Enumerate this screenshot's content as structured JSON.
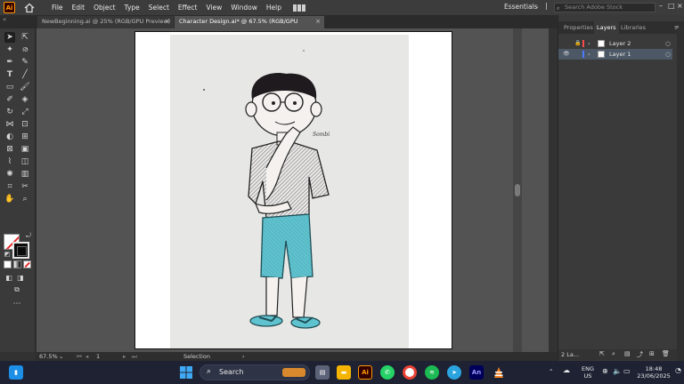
{
  "app": {
    "logo_text": "Ai",
    "menu": [
      "File",
      "Edit",
      "Object",
      "Type",
      "Select",
      "Effect",
      "View",
      "Window",
      "Help"
    ],
    "workspace": "Essentials",
    "stock_search_placeholder": "Search Adobe Stock"
  },
  "tabs": [
    {
      "label": "NewBeginning.ai @ 25% (RGB/GPU Preview)",
      "close": "×"
    },
    {
      "label": "Character Design.ai* @ 67.5% (RGB/GPU Preview)",
      "close": "×"
    }
  ],
  "panel": {
    "tabs": [
      "Properties",
      "Layers",
      "Libraries"
    ],
    "layers": [
      {
        "name": "Layer 2",
        "color": "#ff4b4b"
      },
      {
        "name": "Layer 1",
        "color": "#4b7bff"
      }
    ],
    "footer_count": "2 La..."
  },
  "artwork": {
    "signature": "Sombi"
  },
  "status": {
    "zoom": "67.5%",
    "artboard_nav": "1",
    "tool_name": "Selection"
  },
  "taskbar": {
    "search_label": "Search",
    "lang_top": "ENG",
    "lang_bottom": "US",
    "time": "18:48",
    "date": "23/06/2025"
  },
  "colors": {
    "accent_orange": "#ff9a00",
    "shorts_blue": "#5fc3cf",
    "selected_layer": "#4c5866"
  }
}
